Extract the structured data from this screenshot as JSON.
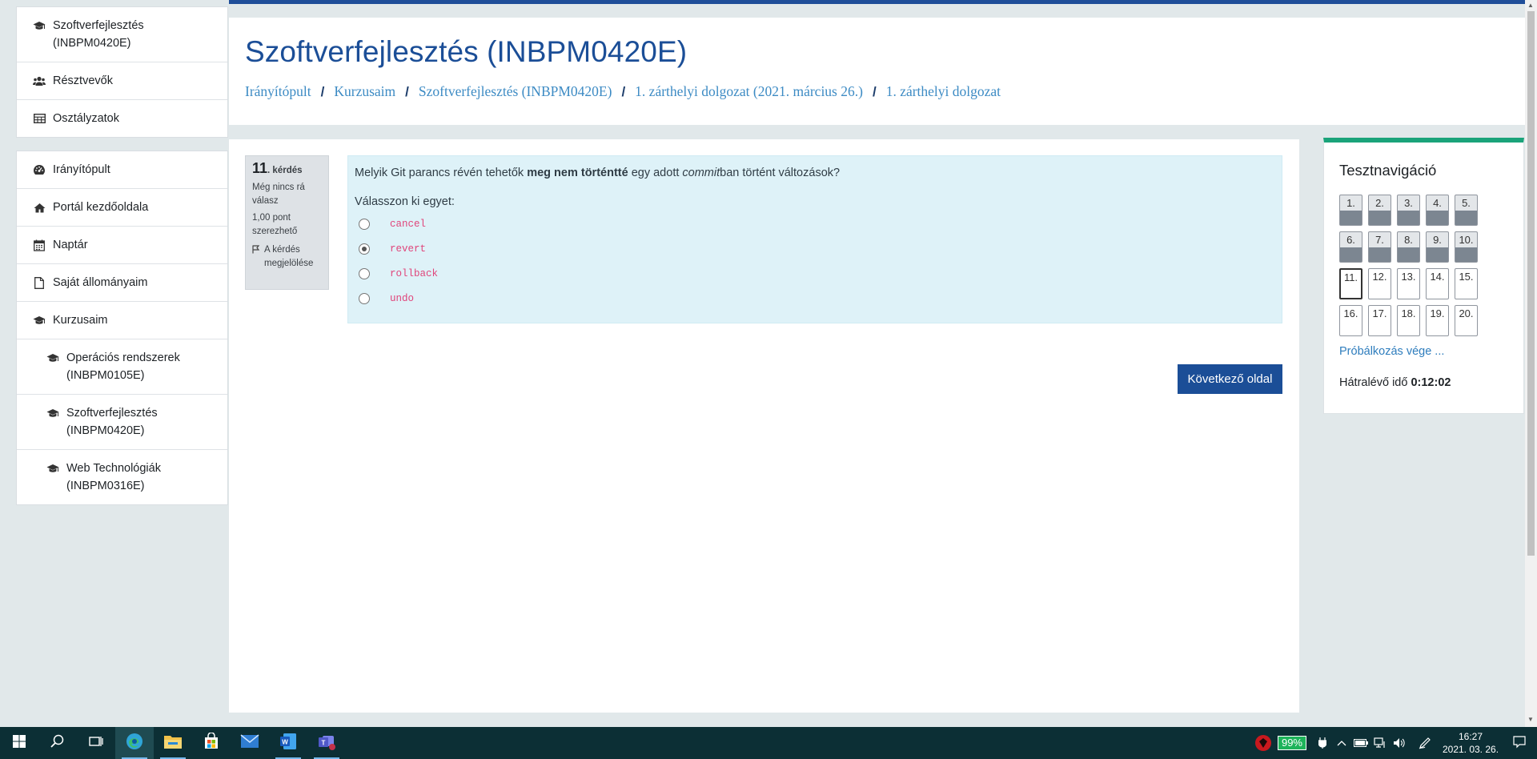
{
  "sidebar_course": {
    "items": [
      {
        "label": "Szoftverfejlesztés (INBPM0420E)",
        "icon": "graduation-cap-icon"
      },
      {
        "label": "Résztvevők",
        "icon": "users-icon"
      },
      {
        "label": "Osztályzatok",
        "icon": "table-icon"
      }
    ]
  },
  "sidebar_nav": {
    "items": [
      {
        "label": "Irányítópult",
        "icon": "dashboard-icon"
      },
      {
        "label": "Portál kezdőoldala",
        "icon": "home-icon"
      },
      {
        "label": "Naptár",
        "icon": "calendar-icon"
      },
      {
        "label": "Saját állományaim",
        "icon": "file-icon"
      },
      {
        "label": "Kurzusaim",
        "icon": "graduation-cap-icon"
      },
      {
        "label": "Operációs rendszerek (INBPM0105E)",
        "icon": "graduation-cap-icon"
      },
      {
        "label": "Szoftverfejlesztés (INBPM0420E)",
        "icon": "graduation-cap-icon"
      },
      {
        "label": "Web Technológiák (INBPM0316E)",
        "icon": "graduation-cap-icon"
      }
    ]
  },
  "header": {
    "title": "Szoftverfejlesztés (INBPM0420E)",
    "breadcrumb": [
      "Irányítópult",
      "Kurzusaim",
      "Szoftverfejlesztés (INBPM0420E)",
      "1. zárthelyi dolgozat (2021. március 26.)",
      "1. zárthelyi dolgozat"
    ]
  },
  "question": {
    "number": "11",
    "number_suffix": ". kérdés",
    "state": "Még nincs rá válasz",
    "points": "1,00 pont szerezhető",
    "flag_label": "A kérdés megjelölése",
    "text_pre": "Melyik Git parancs révén tehetők ",
    "text_bold": "meg nem történtté",
    "text_mid": " egy adott ",
    "text_italic": "commit",
    "text_post": "ban történt változások?",
    "prompt": "Válasszon ki egyet:",
    "answers": [
      {
        "label": "cancel",
        "checked": false
      },
      {
        "label": "revert",
        "checked": true
      },
      {
        "label": "rollback",
        "checked": false
      },
      {
        "label": "undo",
        "checked": false
      }
    ],
    "next_button": "Következő oldal"
  },
  "quiz_nav": {
    "title": "Tesztnavigáció",
    "buttons": [
      {
        "label": "1.",
        "state": "answered"
      },
      {
        "label": "2.",
        "state": "answered"
      },
      {
        "label": "3.",
        "state": "answered"
      },
      {
        "label": "4.",
        "state": "answered"
      },
      {
        "label": "5.",
        "state": "answered"
      },
      {
        "label": "6.",
        "state": "answered"
      },
      {
        "label": "7.",
        "state": "answered"
      },
      {
        "label": "8.",
        "state": "answered"
      },
      {
        "label": "9.",
        "state": "answered"
      },
      {
        "label": "10.",
        "state": "answered"
      },
      {
        "label": "11.",
        "state": "current"
      },
      {
        "label": "12.",
        "state": "unanswered"
      },
      {
        "label": "13.",
        "state": "unanswered"
      },
      {
        "label": "14.",
        "state": "unanswered"
      },
      {
        "label": "15.",
        "state": "unanswered"
      },
      {
        "label": "16.",
        "state": "unanswered"
      },
      {
        "label": "17.",
        "state": "unanswered"
      },
      {
        "label": "18.",
        "state": "unanswered"
      },
      {
        "label": "19.",
        "state": "unanswered"
      },
      {
        "label": "20.",
        "state": "unanswered"
      }
    ],
    "finish_link": "Próbálkozás vége ...",
    "timer_label": "Hátralévő idő ",
    "timer_value": "0:12:02"
  },
  "taskbar": {
    "apps": [
      "start-icon",
      "search-icon",
      "task-view-icon",
      "edge-icon",
      "file-explorer-icon",
      "store-icon",
      "mail-icon",
      "word-icon",
      "teams-icon"
    ],
    "battery": "99%",
    "time": "16:27",
    "date": "2021. 03. 26."
  },
  "colors": {
    "brand_blue": "#1b4e97",
    "link_blue": "#3d8bc4",
    "question_bg": "#def2f8",
    "nav_accent": "#1aa37a",
    "code_pink": "#e0457b"
  }
}
